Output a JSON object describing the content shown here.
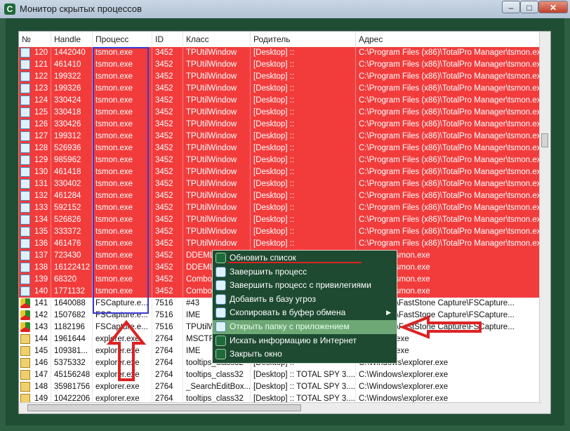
{
  "window": {
    "title": "Монитор скрытых процессов"
  },
  "columns": [
    "№",
    "Handle",
    "Процесс",
    "ID",
    "Класс",
    "Родитель",
    "Адрес"
  ],
  "rows": [
    {
      "n": "120",
      "handle": "1442040",
      "proc": "tsmon.exe",
      "id": "3452",
      "cls": "TPUtilWindow",
      "parent": "[Desktop] ::",
      "addr": "C:\\Program Files (x86)\\TotalPro Manager\\tsmon.exe",
      "style": "red",
      "icon": "window-icon"
    },
    {
      "n": "121",
      "handle": "461410",
      "proc": "tsmon.exe",
      "id": "3452",
      "cls": "TPUtilWindow",
      "parent": "[Desktop] ::",
      "addr": "C:\\Program Files (x86)\\TotalPro Manager\\tsmon.exe",
      "style": "red",
      "icon": "window-icon"
    },
    {
      "n": "122",
      "handle": "199322",
      "proc": "tsmon.exe",
      "id": "3452",
      "cls": "TPUtilWindow",
      "parent": "[Desktop] ::",
      "addr": "C:\\Program Files (x86)\\TotalPro Manager\\tsmon.exe",
      "style": "red",
      "icon": "window-icon"
    },
    {
      "n": "123",
      "handle": "199326",
      "proc": "tsmon.exe",
      "id": "3452",
      "cls": "TPUtilWindow",
      "parent": "[Desktop] ::",
      "addr": "C:\\Program Files (x86)\\TotalPro Manager\\tsmon.exe",
      "style": "red",
      "icon": "window-icon"
    },
    {
      "n": "124",
      "handle": "330424",
      "proc": "tsmon.exe",
      "id": "3452",
      "cls": "TPUtilWindow",
      "parent": "[Desktop] ::",
      "addr": "C:\\Program Files (x86)\\TotalPro Manager\\tsmon.exe",
      "style": "red",
      "icon": "window-icon"
    },
    {
      "n": "125",
      "handle": "330418",
      "proc": "tsmon.exe",
      "id": "3452",
      "cls": "TPUtilWindow",
      "parent": "[Desktop] ::",
      "addr": "C:\\Program Files (x86)\\TotalPro Manager\\tsmon.exe",
      "style": "red",
      "icon": "window-icon"
    },
    {
      "n": "126",
      "handle": "330426",
      "proc": "tsmon.exe",
      "id": "3452",
      "cls": "TPUtilWindow",
      "parent": "[Desktop] ::",
      "addr": "C:\\Program Files (x86)\\TotalPro Manager\\tsmon.exe",
      "style": "red",
      "icon": "window-icon"
    },
    {
      "n": "127",
      "handle": "199312",
      "proc": "tsmon.exe",
      "id": "3452",
      "cls": "TPUtilWindow",
      "parent": "[Desktop] ::",
      "addr": "C:\\Program Files (x86)\\TotalPro Manager\\tsmon.exe",
      "style": "red",
      "icon": "window-icon"
    },
    {
      "n": "128",
      "handle": "526936",
      "proc": "tsmon.exe",
      "id": "3452",
      "cls": "TPUtilWindow",
      "parent": "[Desktop] ::",
      "addr": "C:\\Program Files (x86)\\TotalPro Manager\\tsmon.exe",
      "style": "red",
      "icon": "window-icon"
    },
    {
      "n": "129",
      "handle": "985962",
      "proc": "tsmon.exe",
      "id": "3452",
      "cls": "TPUtilWindow",
      "parent": "[Desktop] ::",
      "addr": "C:\\Program Files (x86)\\TotalPro Manager\\tsmon.exe",
      "style": "red",
      "icon": "window-icon"
    },
    {
      "n": "130",
      "handle": "461418",
      "proc": "tsmon.exe",
      "id": "3452",
      "cls": "TPUtilWindow",
      "parent": "[Desktop] ::",
      "addr": "C:\\Program Files (x86)\\TotalPro Manager\\tsmon.exe",
      "style": "red",
      "icon": "window-icon"
    },
    {
      "n": "131",
      "handle": "330402",
      "proc": "tsmon.exe",
      "id": "3452",
      "cls": "TPUtilWindow",
      "parent": "[Desktop] ::",
      "addr": "C:\\Program Files (x86)\\TotalPro Manager\\tsmon.exe",
      "style": "red",
      "icon": "window-icon"
    },
    {
      "n": "132",
      "handle": "461284",
      "proc": "tsmon.exe",
      "id": "3452",
      "cls": "TPUtilWindow",
      "parent": "[Desktop] ::",
      "addr": "C:\\Program Files (x86)\\TotalPro Manager\\tsmon.exe",
      "style": "red",
      "icon": "window-icon"
    },
    {
      "n": "133",
      "handle": "592152",
      "proc": "tsmon.exe",
      "id": "3452",
      "cls": "TPUtilWindow",
      "parent": "[Desktop] ::",
      "addr": "C:\\Program Files (x86)\\TotalPro Manager\\tsmon.exe",
      "style": "red",
      "icon": "window-icon"
    },
    {
      "n": "134",
      "handle": "526826",
      "proc": "tsmon.exe",
      "id": "3452",
      "cls": "TPUtilWindow",
      "parent": "[Desktop] ::",
      "addr": "C:\\Program Files (x86)\\TotalPro Manager\\tsmon.exe",
      "style": "red",
      "icon": "window-icon"
    },
    {
      "n": "135",
      "handle": "333372",
      "proc": "tsmon.exe",
      "id": "3452",
      "cls": "TPUtilWindow",
      "parent": "[Desktop] ::",
      "addr": "C:\\Program Files (x86)\\TotalPro Manager\\tsmon.exe",
      "style": "red",
      "icon": "window-icon"
    },
    {
      "n": "136",
      "handle": "461476",
      "proc": "tsmon.exe",
      "id": "3452",
      "cls": "TPUtilWindow",
      "parent": "[Desktop] ::",
      "addr": "C:\\Program Files (x86)\\TotalPro Manager\\tsmon.exe",
      "style": "red",
      "icon": "window-icon"
    },
    {
      "n": "137",
      "handle": "723430",
      "proc": "tsmon.exe",
      "id": "3452",
      "cls": "DDEML",
      "parent": "",
      "addr": "Manager\\tsmon.exe",
      "style": "red",
      "icon": "window-icon"
    },
    {
      "n": "138",
      "handle": "16122412",
      "proc": "tsmon.exe",
      "id": "3452",
      "cls": "DDEML",
      "parent": "",
      "addr": "Manager\\tsmon.exe",
      "style": "red",
      "icon": "window-icon"
    },
    {
      "n": "139",
      "handle": "68320",
      "proc": "tsmon.exe",
      "id": "3452",
      "cls": "ComboL",
      "parent": "",
      "addr": "Manager\\tsmon.exe",
      "style": "red",
      "icon": "window-icon"
    },
    {
      "n": "140",
      "handle": "1771132",
      "proc": "tsmon.exe",
      "id": "3452",
      "cls": "ComboL",
      "parent": "",
      "addr": "Manager\\tsmon.exe",
      "style": "red",
      "icon": "window-icon"
    },
    {
      "n": "141",
      "handle": "1640088",
      "proc": "FSCapture.e...",
      "id": "7516",
      "cls": "#43",
      "parent": "",
      "addr": "Files (x86)\\FastStone Capture\\FSCapture...",
      "style": "white",
      "icon": "fscapture-icon"
    },
    {
      "n": "142",
      "handle": "1507682",
      "proc": "FSCapture.e...",
      "id": "7516",
      "cls": "IME",
      "parent": "",
      "addr": "Files (x86)\\FastStone Capture\\FSCapture...",
      "style": "white",
      "icon": "fscapture-icon"
    },
    {
      "n": "143",
      "handle": "1182196",
      "proc": "FSCapture.e...",
      "id": "7516",
      "cls": "TPUtilWi",
      "parent": "",
      "addr": "Files (x86)\\FastStone Capture\\FSCapture...",
      "style": "white",
      "icon": "fscapture-icon"
    },
    {
      "n": "144",
      "handle": "1961644",
      "proc": "explorer.exe",
      "id": "2764",
      "cls": "MSCTFU",
      "parent": "",
      "addr": "s\\explorer.exe",
      "style": "white",
      "icon": "explorer-icon"
    },
    {
      "n": "145",
      "handle": "109381...",
      "proc": "explorer.exe",
      "id": "2764",
      "cls": "IME",
      "parent": "",
      "addr": "s\\explorer.exe",
      "style": "white",
      "icon": "explorer-icon"
    },
    {
      "n": "146",
      "handle": "5375332",
      "proc": "explorer.exe",
      "id": "2764",
      "cls": "tooltips_class32",
      "parent": "[Desktop] ::",
      "addr": "C:\\Windows\\explorer.exe",
      "style": "white",
      "icon": "explorer-icon"
    },
    {
      "n": "147",
      "handle": "45156248",
      "proc": "explorer.exe",
      "id": "2764",
      "cls": "tooltips_class32",
      "parent": "[Desktop] :: TOTAL SPY 3....",
      "addr": "C:\\Windows\\explorer.exe",
      "style": "white",
      "icon": "explorer-icon"
    },
    {
      "n": "148",
      "handle": "35981756",
      "proc": "explorer.exe",
      "id": "2764",
      "cls": "_SearchEditBox...",
      "parent": "[Desktop] :: TOTAL SPY 3....",
      "addr": "C:\\Windows\\explorer.exe",
      "style": "white",
      "icon": "explorer-icon"
    },
    {
      "n": "149",
      "handle": "10422206",
      "proc": "explorer.exe",
      "id": "2764",
      "cls": "tooltips_class32",
      "parent": "[Desktop] :: TOTAL SPY 3....",
      "addr": "C:\\Windows\\explorer.exe",
      "style": "white",
      "icon": "explorer-icon"
    }
  ],
  "context_menu": [
    {
      "label": "Обновить список",
      "icon": "app-icon"
    },
    {
      "label": "Завершить процесс",
      "icon": "window-icon"
    },
    {
      "label": "Завершить процесс с привилегиями",
      "icon": "window-icon"
    },
    {
      "label": "Добавить в базу угроз",
      "icon": "window-icon"
    },
    {
      "label": "Скопировать в буфер обмена",
      "icon": "window-icon",
      "submenu": true
    },
    {
      "label": "Открыть папку с приложением",
      "icon": "window-icon",
      "highlighted": true
    },
    {
      "label": "Искать информацию в Интернет",
      "icon": "app-icon"
    },
    {
      "label": "Закрыть окно",
      "icon": "app-icon"
    }
  ],
  "colors": {
    "row_red": "#f23c3c",
    "menu_bg": "#1d4a30",
    "highlight": "#6ea876",
    "annotation": "#d22"
  }
}
